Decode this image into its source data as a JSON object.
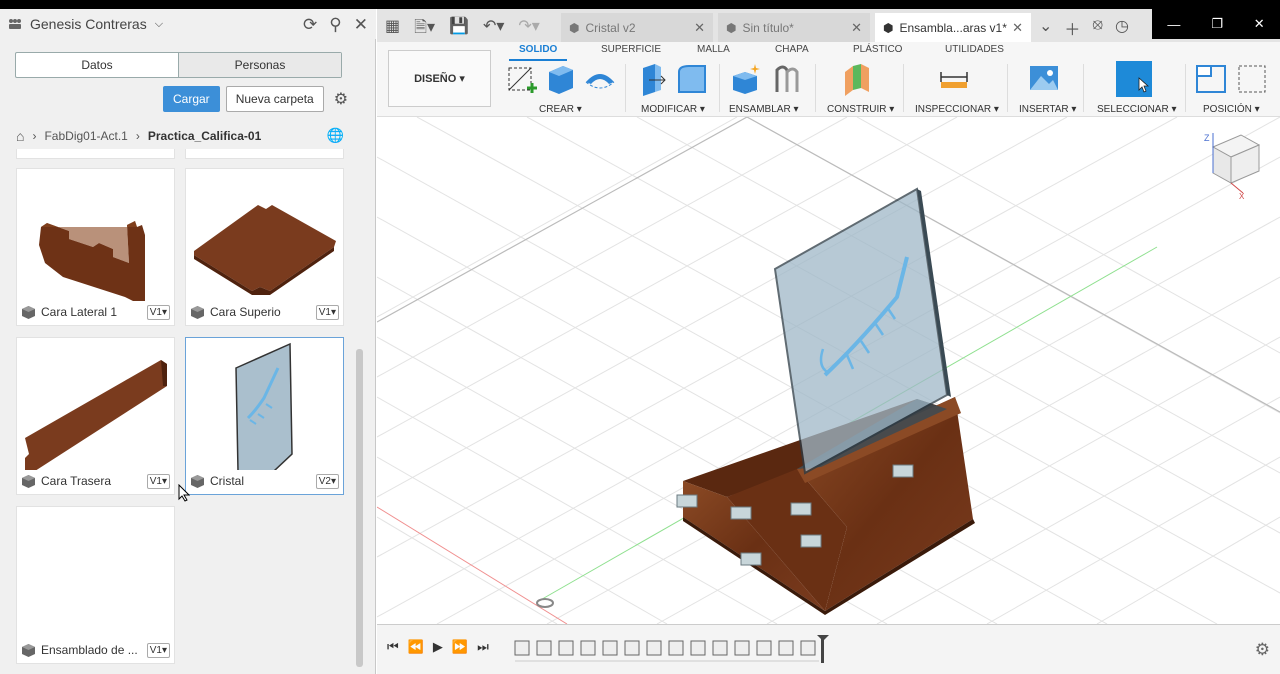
{
  "panel": {
    "team_name": "Genesis Contreras",
    "tabs": [
      "Datos",
      "Personas"
    ],
    "load_button": "Cargar",
    "new_folder_button": "Nueva carpeta",
    "breadcrumb": [
      "FabDig01-Act.1",
      "Practica_Califica-01"
    ],
    "files": [
      {
        "name": "Cara Lateral 1",
        "version": "V1"
      },
      {
        "name": "Cara Superio",
        "version": "V1"
      },
      {
        "name": "Cara Trasera",
        "version": "V1"
      },
      {
        "name": "Cristal",
        "version": "V2"
      },
      {
        "name": "Ensamblado de ...",
        "version": "V1"
      }
    ]
  },
  "doc_tabs": [
    {
      "label": "Cristal v2"
    },
    {
      "label": "Sin título*"
    },
    {
      "label": "Ensambla...aras v1*"
    }
  ],
  "ribbon": {
    "workspace": "DISEÑO",
    "tabs": [
      "SOLIDO",
      "SUPERFICIE",
      "MALLA",
      "CHAPA",
      "PLÁSTICO",
      "UTILIDADES"
    ],
    "groups": [
      "CREAR",
      "MODIFICAR",
      "ENSAMBLAR",
      "CONSTRUIR",
      "INSPECCIONAR",
      "INSERTAR",
      "SELECCIONAR",
      "POSICIÓN"
    ]
  },
  "colors": {
    "accent": "#1a7fd4",
    "wood": "#7a3b1e",
    "glass": "#9fb8c8"
  }
}
